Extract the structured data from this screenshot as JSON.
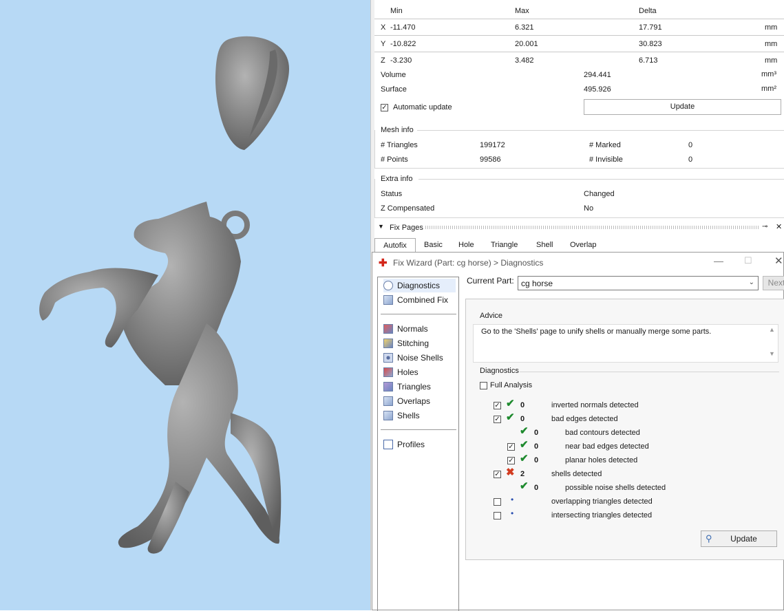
{
  "bbox": {
    "headers": [
      "Min",
      "Max",
      "Delta"
    ],
    "rows": [
      {
        "axis": "X",
        "min": "-11.470",
        "max": "6.321",
        "delta": "17.791",
        "unit": "mm"
      },
      {
        "axis": "Y",
        "min": "-10.822",
        "max": "20.001",
        "delta": "30.823",
        "unit": "mm"
      },
      {
        "axis": "Z",
        "min": "-3.230",
        "max": "3.482",
        "delta": "6.713",
        "unit": "mm"
      }
    ],
    "volume_label": "Volume",
    "volume": "294.441",
    "volume_unit": "mm³",
    "surface_label": "Surface",
    "surface": "495.926",
    "surface_unit": "mm²",
    "auto_update_label": "Automatic update",
    "update_label": "Update"
  },
  "mesh_info": {
    "title": "Mesh info",
    "triangles_label": "# Triangles",
    "triangles": "199172",
    "marked_label": "# Marked",
    "marked": "0",
    "points_label": "# Points",
    "points": "99586",
    "invisible_label": "# Invisible",
    "invisible": "0"
  },
  "extra_info": {
    "title": "Extra info",
    "status_label": "Status",
    "status": "Changed",
    "zcomp_label": "Z Compensated",
    "zcomp": "No"
  },
  "fix_pages": {
    "title": "Fix Pages",
    "tabs": [
      "Autofix",
      "Basic",
      "Hole",
      "Triangle",
      "Shell",
      "Overlap"
    ]
  },
  "wizard": {
    "title": "Fix Wizard (Part: cg horse) > Diagnostics",
    "nav": [
      "Diagnostics",
      "Combined Fix",
      "Normals",
      "Stitching",
      "Noise Shells",
      "Holes",
      "Triangles",
      "Overlaps",
      "Shells",
      "Profiles"
    ],
    "current_part_label": "Current Part:",
    "current_part": "cg horse",
    "next_label": "Next",
    "advice_title": "Advice",
    "advice_text": "Go to the 'Shells' page to unify shells or manually merge some parts.",
    "diagnostics_title": "Diagnostics",
    "full_analysis_label": "Full Analysis",
    "rows": [
      {
        "count": "0",
        "label": "inverted normals detected"
      },
      {
        "count": "0",
        "label": "bad edges detected"
      },
      {
        "count": "0",
        "label": "bad contours detected"
      },
      {
        "count": "0",
        "label": "near bad edges detected"
      },
      {
        "count": "0",
        "label": "planar holes detected"
      },
      {
        "count": "2",
        "label": "shells detected"
      },
      {
        "count": "0",
        "label": "possible noise shells detected"
      },
      {
        "count": "",
        "label": "overlapping triangles detected"
      },
      {
        "count": "",
        "label": "intersecting triangles detected"
      }
    ],
    "update_label": "Update"
  },
  "colors": {
    "viewport_bg": "#b7d9f5",
    "model": "#8a8a8a",
    "ok": "#1e8a2e",
    "error": "#d23b20"
  }
}
